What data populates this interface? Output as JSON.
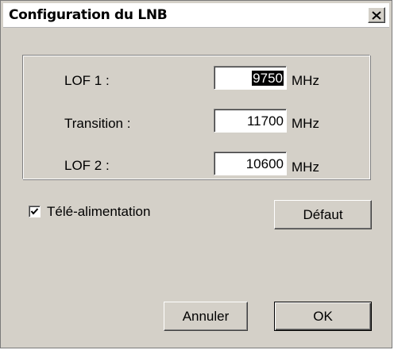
{
  "window": {
    "title": "Configuration du LNB",
    "close_icon": "close-icon"
  },
  "lnb": {
    "lof1_label": "LOF 1 :",
    "lof1_value": "9750",
    "lof1_unit": "MHz",
    "transition_label": "Transition :",
    "transition_value": "11700",
    "transition_unit": "MHz",
    "lof2_label": "LOF 2 :",
    "lof2_value": "10600",
    "lof2_unit": "MHz"
  },
  "power": {
    "label": "Télé-alimentation",
    "checked": true
  },
  "buttons": {
    "default_label": "Défaut",
    "cancel_label": "Annuler",
    "ok_label": "OK"
  }
}
